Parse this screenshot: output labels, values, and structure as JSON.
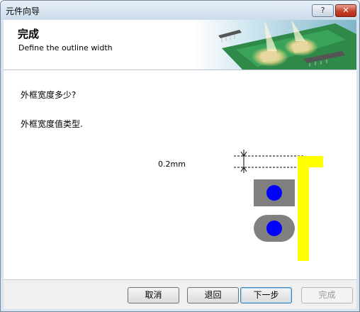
{
  "window": {
    "title": "元件向导",
    "help_label": "?",
    "close_label": "✕"
  },
  "header": {
    "title": "完成",
    "subtitle": "Define the outline width"
  },
  "body": {
    "question": "外框宽度多少?",
    "instruction": "外框宽度值类型.",
    "width_value": "0.2mm"
  },
  "diagram": {
    "outline_color": "#ffff00",
    "pad_color": "#808080",
    "hole_color": "#0000ff"
  },
  "buttons": {
    "cancel": "取消",
    "back": "退回",
    "next": "下一步",
    "finish": "完成"
  }
}
